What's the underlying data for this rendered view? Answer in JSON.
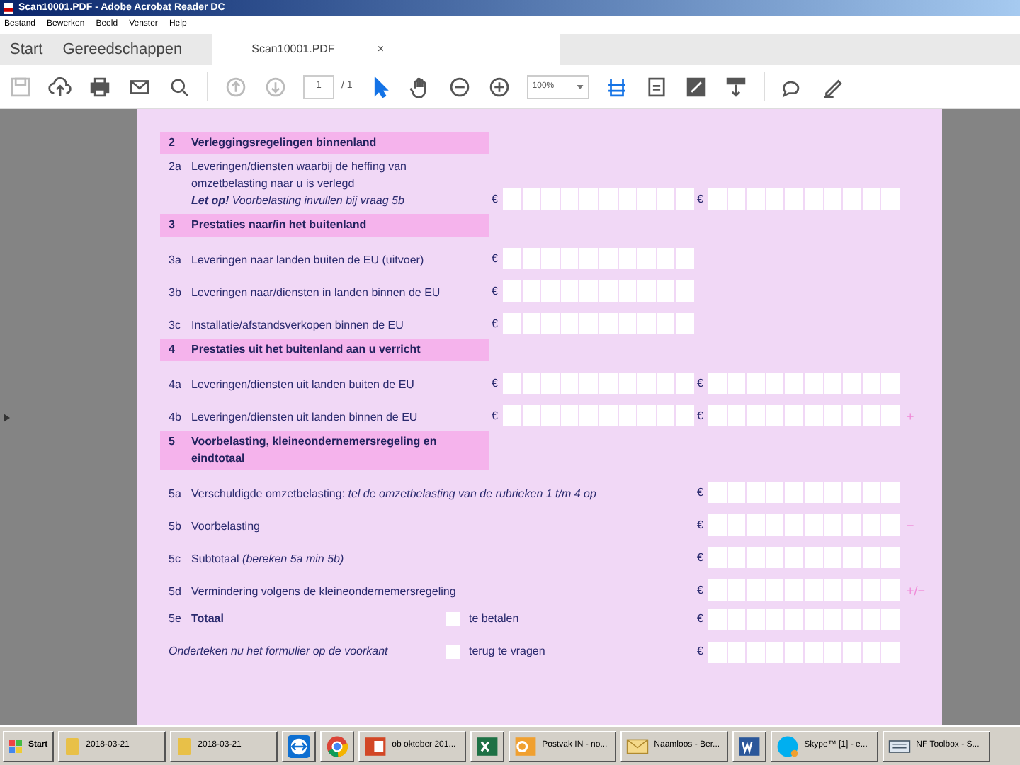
{
  "window": {
    "title": "Scan10001.PDF - Adobe Acrobat Reader DC"
  },
  "menu": [
    "Bestand",
    "Bewerken",
    "Beeld",
    "Venster",
    "Help"
  ],
  "tabs": [
    {
      "label": "Start",
      "selected": false
    },
    {
      "label": "Gereedschappen",
      "selected": false
    },
    {
      "label": "Scan10001.PDF",
      "selected": true,
      "close": "×"
    }
  ],
  "toolbar": {
    "page": "1",
    "page_total": "/ 1",
    "zoom": "100%"
  },
  "form": [
    {
      "kind": "section",
      "code": "2",
      "title": "Verleggingsregelingen binnenland"
    },
    {
      "kind": "line",
      "code": "2a",
      "label": "Leveringen/diensten waarbij de heffing van omzetbelasting naar u is verlegd",
      "note": "**Let op!** Voorbelasting invullen bij vraag 5b",
      "col1": "€",
      "col2": "€"
    },
    {
      "kind": "section",
      "code": "3",
      "title": "Prestaties naar/in het buitenland"
    },
    {
      "kind": "line",
      "code": "3a",
      "label": "Leveringen naar landen buiten de EU (uitvoer)",
      "col1": "€"
    },
    {
      "kind": "line",
      "code": "3b",
      "label": "Leveringen naar/diensten in landen binnen de EU",
      "col1": "€"
    },
    {
      "kind": "line",
      "code": "3c",
      "label": "Installatie/afstandsverkopen binnen de EU",
      "col1": "€"
    },
    {
      "kind": "section",
      "code": "4",
      "title": "Prestaties uit het buitenland aan u verricht"
    },
    {
      "kind": "line",
      "code": "4a",
      "label": "Leveringen/diensten uit landen buiten de EU",
      "col1": "€",
      "col2": "€"
    },
    {
      "kind": "line",
      "code": "4b",
      "label": "Leveringen/diensten uit landen binnen de EU",
      "col1": "€",
      "col2": "€",
      "sign": "+"
    },
    {
      "kind": "section",
      "code": "5",
      "title": "Voorbelasting, kleineondernemersregeling en eindtotaal"
    },
    {
      "kind": "line",
      "code": "5a",
      "label": "Verschuldigde omzetbelasting: *tel de omzetbelasting van de rubrieken 1 t/m 4 op*",
      "col2": "€"
    },
    {
      "kind": "line",
      "code": "5b",
      "label": "Voorbelasting",
      "col2": "€",
      "sign": "−"
    },
    {
      "kind": "line",
      "code": "5c",
      "label": "Subtotaal *(bereken 5a min 5b)*",
      "col2": "€"
    },
    {
      "kind": "line",
      "code": "5d",
      "label": "Vermindering volgens de kleineondernemersregeling",
      "col2": "€",
      "sign": "+/−"
    },
    {
      "kind": "total",
      "code": "5e",
      "label": "Totaal",
      "checkbox": "te betalen",
      "checked": false,
      "col2": "€"
    },
    {
      "kind": "signoff",
      "label": "Onderteken nu het formulier op de voorkant",
      "checkbox": "terug te vragen",
      "checked": false,
      "col2": "€"
    }
  ],
  "taskbar": [
    {
      "kind": "start",
      "label": "Start"
    },
    {
      "kind": "folder",
      "label": "2018-03-21"
    },
    {
      "kind": "folder",
      "label": "2018-03-21"
    },
    {
      "kind": "teamviewer"
    },
    {
      "kind": "chrome"
    },
    {
      "kind": "powerpoint",
      "label": "ob oktober 201..."
    },
    {
      "kind": "excel"
    },
    {
      "kind": "outlook",
      "label": "Postvak IN - no..."
    },
    {
      "kind": "mail",
      "label": "Naamloos - Ber..."
    },
    {
      "kind": "word"
    },
    {
      "kind": "skype",
      "label": "Skype™ [1] - e..."
    },
    {
      "kind": "toolbox",
      "label": "NF Toolbox - S..."
    }
  ]
}
